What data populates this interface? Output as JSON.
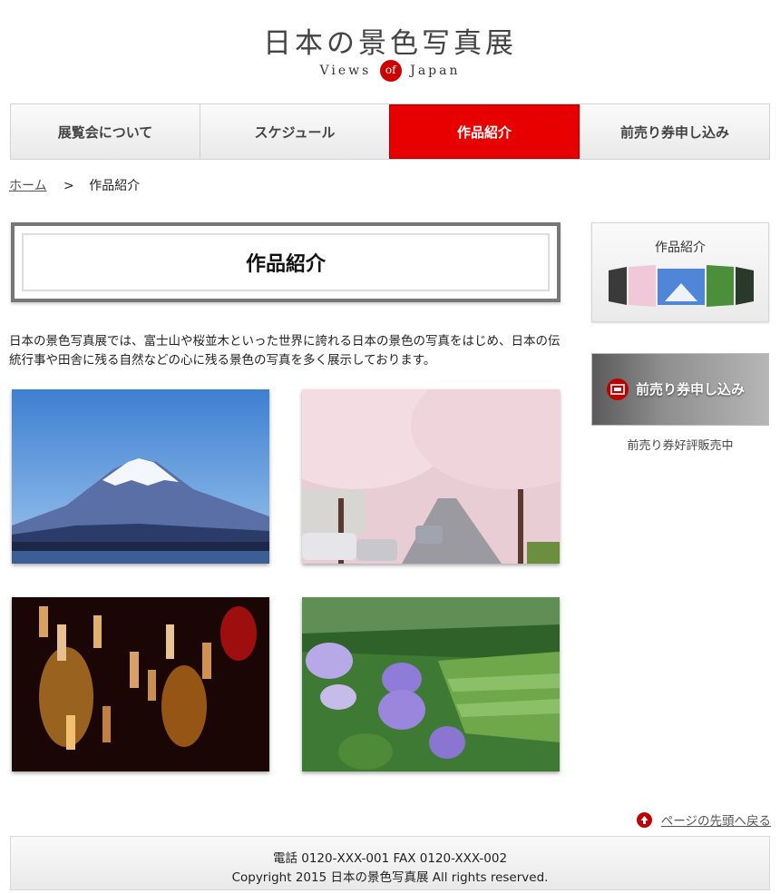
{
  "header": {
    "title": "日本の景色写真展",
    "subtitle_before": "Views",
    "subtitle_of": "of",
    "subtitle_after": "Japan"
  },
  "nav": {
    "items": [
      {
        "label": "展覧会について"
      },
      {
        "label": "スケジュール"
      },
      {
        "label": "作品紹介"
      },
      {
        "label": "前売り券申し込み"
      }
    ],
    "active_index": 2,
    "active_color": "#e60000"
  },
  "breadcrumb": {
    "home": "ホーム",
    "separator": ">",
    "current": "作品紹介"
  },
  "main": {
    "heading": "作品紹介",
    "intro": "日本の景色写真展では、富士山や桜並木といった世界に誇れる日本の景色の写真をはじめ、日本の伝統行事や田舎に残る自然などの心に残る景色の写真を多く展示しております。",
    "photos": [
      {
        "icon": "mount-fuji-photo"
      },
      {
        "icon": "cherry-blossom-avenue-photo"
      },
      {
        "icon": "tanabata-lanterns-photo"
      },
      {
        "icon": "hydrangea-terraced-fields-photo"
      }
    ]
  },
  "sidebar": {
    "card_title": "作品紹介",
    "banner_label": "前売り券申し込み",
    "banner_caption": "前売り券好評販売中"
  },
  "to_top": {
    "label": "ページの先頭へ戻る"
  },
  "footer": {
    "contact": "電話 0120-XXX-001 FAX 0120-XXX-002",
    "copyright": "Copyright 2015 日本の景色写真展 All rights reserved."
  },
  "colors": {
    "accent": "#cc0000"
  }
}
